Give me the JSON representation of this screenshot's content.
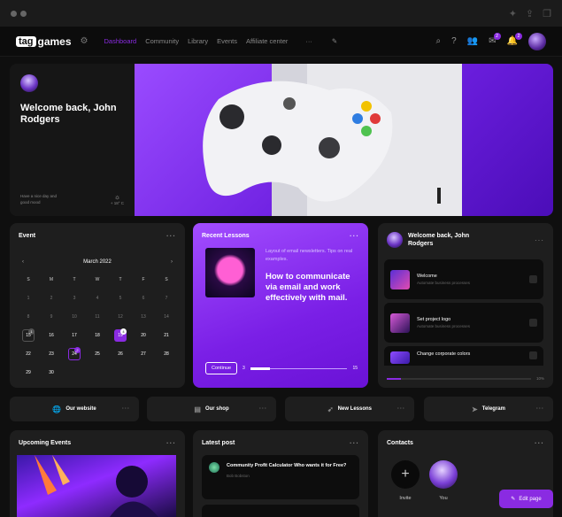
{
  "nav": {
    "logo_tag": "tag",
    "logo_text": "games",
    "menu": [
      {
        "label": "Dashboard",
        "active": true
      },
      {
        "label": "Community",
        "active": false
      },
      {
        "label": "Library",
        "active": false
      },
      {
        "label": "Events",
        "active": false
      },
      {
        "label": "Affiliate center",
        "active": false
      }
    ],
    "more": "···",
    "badges": {
      "messages": "2",
      "notifications": "2"
    }
  },
  "hero": {
    "title": "Welcome back, John Rodgers",
    "greeting": "Have a nice day and good mood",
    "temperature": "+ 18° C"
  },
  "event_card": {
    "title": "Event",
    "month": "March 2022",
    "prev": "‹",
    "next": "›",
    "days_of_week": [
      "S",
      "M",
      "T",
      "W",
      "T",
      "F",
      "S"
    ],
    "weeks": [
      [
        "1",
        "2",
        "3",
        "4",
        "5",
        "6",
        "7"
      ],
      [
        "8",
        "9",
        "10",
        "11",
        "12",
        "13",
        "14"
      ],
      [
        "15",
        "16",
        "17",
        "18",
        "19",
        "20",
        "21"
      ],
      [
        "22",
        "23",
        "24",
        "25",
        "26",
        "27",
        "28"
      ],
      [
        "29",
        "30",
        "",
        "",
        "",
        "",
        ""
      ]
    ],
    "markers": [
      {
        "day": "15",
        "count": "1"
      },
      {
        "day": "19",
        "count": "4"
      },
      {
        "day": "24",
        "count": "2"
      }
    ]
  },
  "lessons": {
    "title": "Recent Lessons",
    "subtitle": "Layout of email newsletters. Tips on real examples.",
    "heading": "How to communicate via email and work effectively with mail.",
    "button": "Continue",
    "progress_start": "3",
    "progress_end": "15",
    "progress_value": 0.2
  },
  "welcome_card": {
    "title": "Welcome back, John Rodgers",
    "tasks": [
      {
        "title": "Welcome",
        "subtitle": "Automate business processes"
      },
      {
        "title": "Set project logo",
        "subtitle": "Automate business processes"
      },
      {
        "title": "Change corporate colors",
        "subtitle": ""
      }
    ],
    "progress_label": "10%",
    "progress_value": 0.1
  },
  "quick_links": [
    {
      "label": "Our website",
      "icon": "globe-icon"
    },
    {
      "label": "Our shop",
      "icon": "shop-icon"
    },
    {
      "label": "New Lessons",
      "icon": "rocket-icon"
    },
    {
      "label": "Telegram",
      "icon": "telegram-icon"
    }
  ],
  "upcoming": {
    "title": "Upcoming Events"
  },
  "latest": {
    "title": "Latest post",
    "post_title": "Community Profit Calculator Who wants it for Free?",
    "post_author": "Bob Bobston"
  },
  "contacts": {
    "title": "Contacts",
    "items": [
      {
        "label": "Invite"
      },
      {
        "label": "You"
      }
    ]
  },
  "edit_button": "Edit page",
  "colors": {
    "accent": "#8a2be2",
    "background": "#0f0f0f",
    "card": "#1e1e1e"
  }
}
